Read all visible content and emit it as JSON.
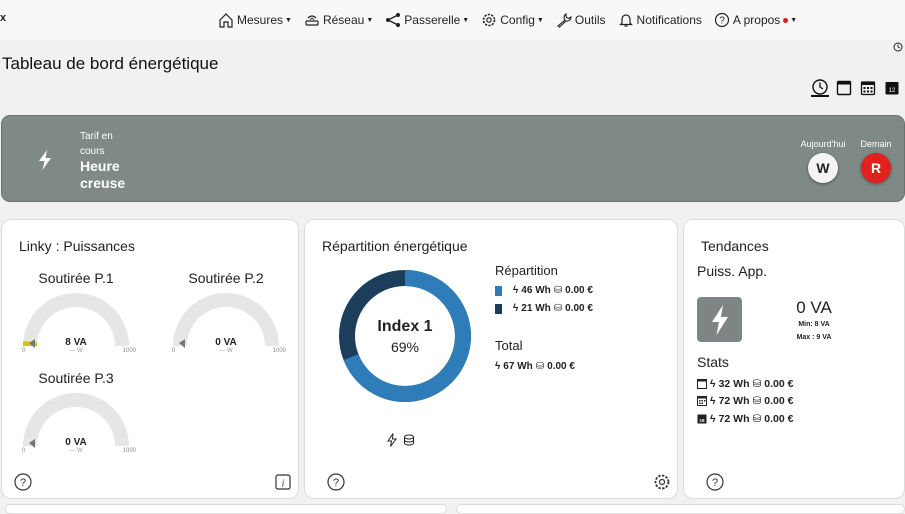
{
  "brand": "x",
  "nav": {
    "mesures": "Mesures",
    "reseau": "Réseau",
    "passerelle": "Passerelle",
    "config": "Config",
    "outils": "Outils",
    "notifications": "Notifications",
    "apropos": "A propos"
  },
  "page": {
    "title": "Tableau de bord énergétique"
  },
  "tarif": {
    "label": "Tarif en cours",
    "value": "Heure creuse",
    "today_label": "Aujourd'hui",
    "today_value": "W",
    "tomorrow_label": "Demain",
    "tomorrow_value": "R"
  },
  "linky": {
    "title": "Linky : Puissances",
    "gauges": [
      {
        "title": "Soutirée P.1",
        "value": "8 VA",
        "unit": "— W",
        "min": "0",
        "max": "1000",
        "fraction": 0.008
      },
      {
        "title": "Soutirée P.2",
        "value": "0 VA",
        "unit": "— W",
        "min": "0",
        "max": "1000",
        "fraction": 0
      },
      {
        "title": "Soutirée P.3",
        "value": "0 VA",
        "unit": "— W",
        "min": "0",
        "max": "1000",
        "fraction": 0
      }
    ]
  },
  "repartition": {
    "title": "Répartition énergétique",
    "donut_label": "Index 1",
    "donut_percent": "69%",
    "donut_fraction": 0.69,
    "rep_heading": "Répartition",
    "rows": [
      {
        "energy": "46 Wh",
        "cost": "0.00 €",
        "color": "#2e7db8"
      },
      {
        "energy": "21 Wh",
        "cost": "0.00 €",
        "color": "#1c3e5a"
      }
    ],
    "total_heading": "Total",
    "total": {
      "energy": "67 Wh",
      "cost": "0.00 €"
    }
  },
  "tendances": {
    "title": "Tendances",
    "subtitle": "Puiss. App.",
    "value": "0 VA",
    "min": "Min: 8 VA",
    "max": "Max : 9 VA",
    "stats_heading": "Stats",
    "stats": [
      {
        "energy": "32 Wh",
        "cost": "0.00 €"
      },
      {
        "energy": "72 Wh",
        "cost": "0.00 €"
      },
      {
        "energy": "72 Wh",
        "cost": "0.00 €"
      }
    ]
  },
  "colors": {
    "tarif_bg": "#7f8a87",
    "donut_main": "#2e7db8",
    "donut_dark": "#1c3e5a",
    "red": "#e0211d"
  }
}
